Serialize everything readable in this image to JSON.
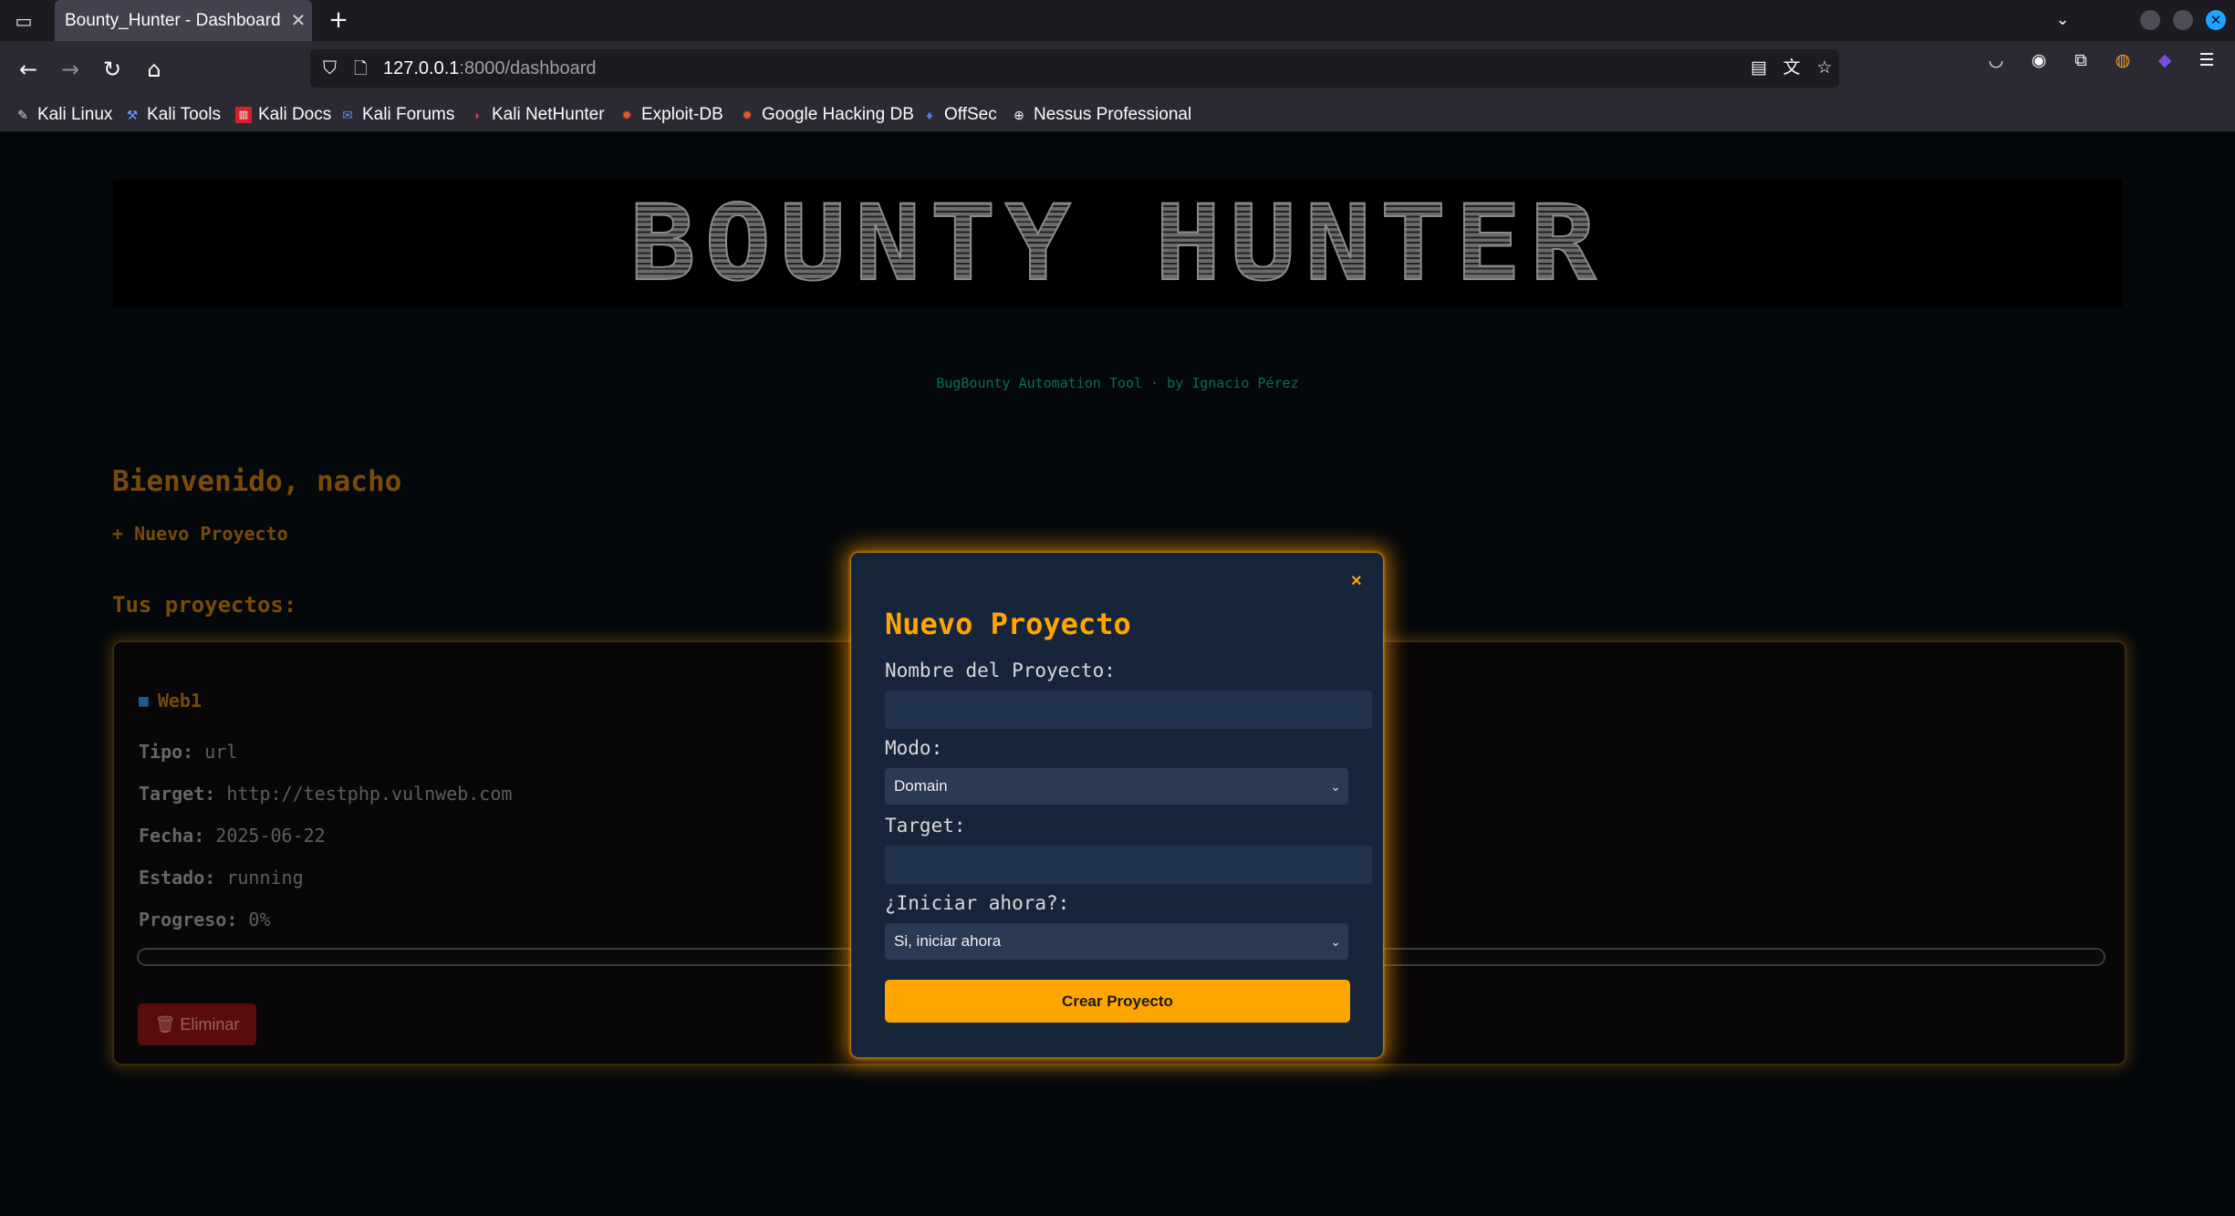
{
  "browser": {
    "tab_title": "Bounty_Hunter - Dashboard",
    "url_host": "127.0.0.1",
    "url_path": ":8000/dashboard",
    "bookmarks": [
      {
        "label": "Kali Linux",
        "icon": "kali-dragon-icon"
      },
      {
        "label": "Kali Tools",
        "icon": "kali-tools-icon"
      },
      {
        "label": "Kali Docs",
        "icon": "kali-docs-icon"
      },
      {
        "label": "Kali Forums",
        "icon": "kali-forums-icon"
      },
      {
        "label": "Kali NetHunter",
        "icon": "nethunter-icon"
      },
      {
        "label": "Exploit-DB",
        "icon": "exploit-db-icon"
      },
      {
        "label": "Google Hacking DB",
        "icon": "ghdb-icon"
      },
      {
        "label": "OffSec",
        "icon": "offsec-icon"
      },
      {
        "label": "Nessus Professional",
        "icon": "globe-icon"
      }
    ]
  },
  "page": {
    "banner_text": "BOUNTY HUNTER",
    "subtitle": "BugBounty Automation Tool · by Ignacio Pérez",
    "welcome": "Bienvenido, nacho",
    "new_project_link": "+ Nuevo Proyecto",
    "projects_heading": "Tus proyectos:"
  },
  "project": {
    "name": "Web1",
    "tipo_label": "Tipo:",
    "tipo": "url",
    "target_label": "Target:",
    "target": "http://testphp.vulnweb.com",
    "fecha_label": "Fecha:",
    "fecha": "2025-06-22",
    "estado_label": "Estado:",
    "estado": "running",
    "progreso_label": "Progreso:",
    "progreso": "0%",
    "progress_fraction": 0,
    "delete_label": "🗑 Eliminar"
  },
  "modal": {
    "close": "×",
    "title": "Nuevo Proyecto",
    "name_label": "Nombre del Proyecto:",
    "name_value": "",
    "mode_label": "Modo:",
    "mode_value": "Domain",
    "target_label": "Target:",
    "target_value": "",
    "start_label": "¿Iniciar ahora?:",
    "start_value": "Si, iniciar ahora",
    "submit": "Crear Proyecto"
  },
  "colors": {
    "accent": "#ffa500",
    "modal_bg": "#16253a",
    "danger": "#5a0b0b"
  }
}
